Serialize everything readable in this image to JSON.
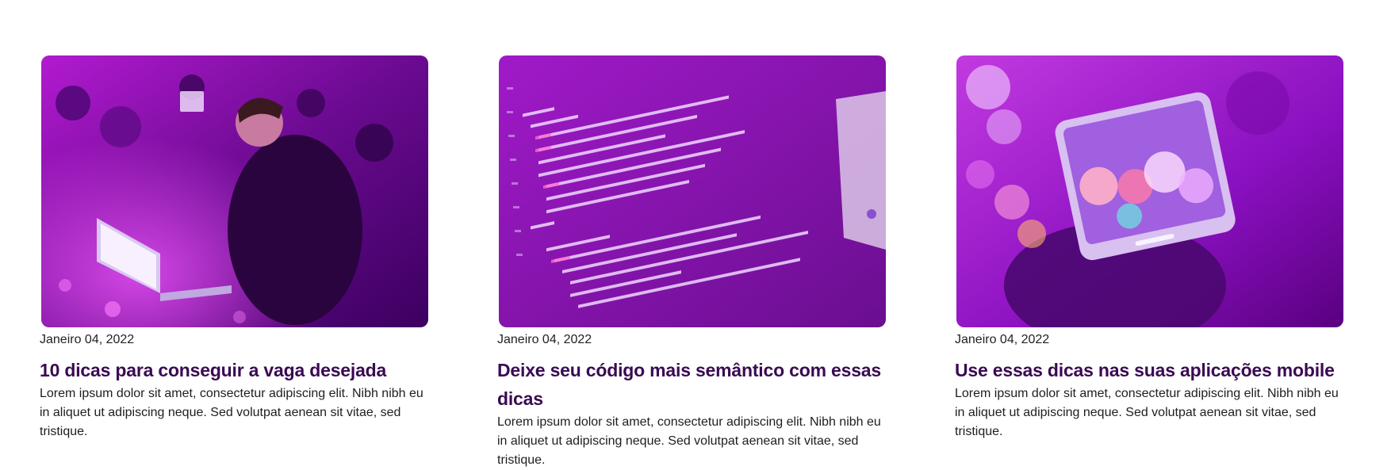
{
  "cards": [
    {
      "image": "people-with-laptops-photo",
      "date": "Janeiro 04, 2022",
      "title": "10 dicas para conseguir a vaga desejada",
      "excerpt": "Lorem ipsum dolor sit amet, consectetur adipiscing elit. Nibh nibh eu in aliquet ut adipiscing neque. Sed volutpat aenean sit vitae, sed tristique."
    },
    {
      "image": "html-code-screen-photo",
      "date": "Janeiro 04, 2022",
      "title": "Deixe seu código mais semântico com essas dicas",
      "excerpt": "Lorem ipsum dolor sit amet, consectetur adipiscing elit. Nibh nibh eu in aliquet ut adipiscing neque. Sed volutpat aenean sit vitae, sed tristique."
    },
    {
      "image": "smartphone-bokeh-photo",
      "date": "Janeiro 04, 2022",
      "title": "Use essas dicas nas suas aplicações mobile",
      "excerpt": "Lorem ipsum dolor sit amet, consectetur adipiscing elit. Nibh nibh eu in aliquet ut adipiscing neque. Sed volutpat aenean sit vitae, sed tristique."
    }
  ],
  "colors": {
    "title": "#3a0a52",
    "overlay": "#8a0ab0"
  }
}
